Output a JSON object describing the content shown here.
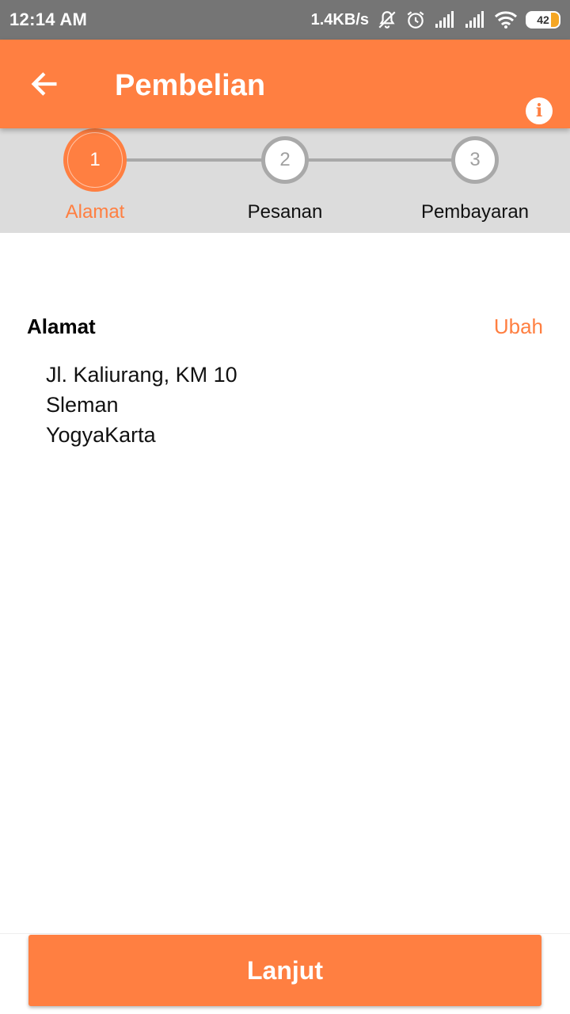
{
  "status_bar": {
    "time": "12:14 AM",
    "net_speed": "1.4KB/s",
    "battery_level": "42",
    "icons": [
      "mute-icon",
      "alarm-icon",
      "signal-icon",
      "signal-icon",
      "wifi-icon",
      "battery-icon"
    ]
  },
  "app_bar": {
    "title": "Pembelian",
    "back_icon": "arrow-left-icon",
    "info_icon": "info-icon",
    "info_glyph": "i"
  },
  "stepper": {
    "active_step": 1,
    "steps": [
      {
        "number": "1",
        "label": "Alamat"
      },
      {
        "number": "2",
        "label": "Pesanan"
      },
      {
        "number": "3",
        "label": "Pembayaran"
      }
    ]
  },
  "address": {
    "title": "Alamat",
    "edit_label": "Ubah",
    "lines": [
      "Jl. Kaliurang, KM 10",
      "Sleman",
      "YogyaKarta"
    ]
  },
  "footer": {
    "next_label": "Lanjut"
  },
  "colors": {
    "accent": "#ff7f41",
    "status_bar": "#757575",
    "stepper_bg": "#dcdcdc",
    "inactive": "#a9a9a9"
  }
}
